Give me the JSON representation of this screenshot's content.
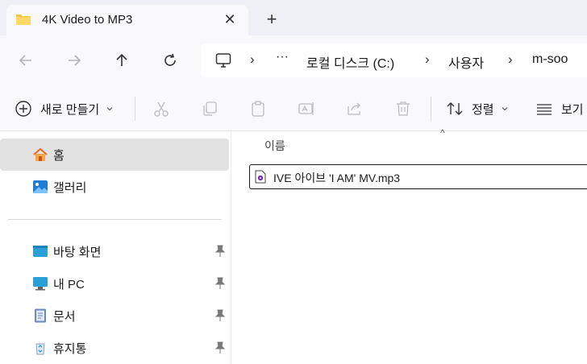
{
  "tab": {
    "title": "4K Video to MP3",
    "close_glyph": "✕",
    "new_tab_glyph": "+"
  },
  "address": {
    "overflow_glyph": "···",
    "crumbs": [
      "로컬 디스크 (C:)",
      "사용자",
      "m-soo"
    ],
    "separator": "›"
  },
  "toolbar": {
    "new_label": "새로 만들기",
    "sort_label": "정렬",
    "view_label": "보기"
  },
  "sidebar": {
    "items": [
      {
        "label": "홈"
      },
      {
        "label": "갤러리"
      },
      {
        "label": "바탕 화면"
      },
      {
        "label": "내 PC"
      },
      {
        "label": "문서"
      },
      {
        "label": "휴지통"
      }
    ]
  },
  "main": {
    "column_name": "이름",
    "sort_glyph": "^",
    "files": [
      {
        "name": "IVE 아이브 'I AM' MV.mp3"
      }
    ]
  },
  "colors": {
    "folder": "#f4c542",
    "accent": "#0067c0",
    "selected_bg": "#e2e2e2"
  }
}
